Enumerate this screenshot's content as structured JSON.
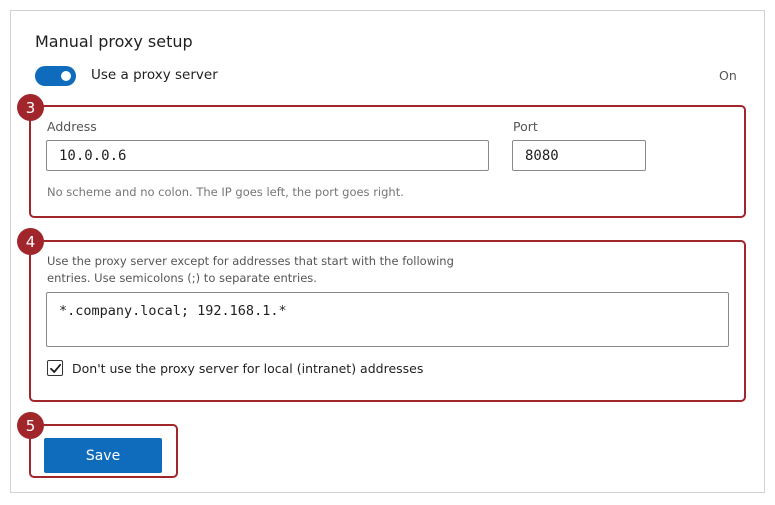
{
  "section": {
    "title": "Manual proxy setup"
  },
  "proxy_toggle": {
    "label": "Use a proxy server",
    "state": "On",
    "enabled": true
  },
  "annotations": [
    "3",
    "4",
    "5"
  ],
  "address": {
    "label": "Address",
    "value": "10.0.0.6"
  },
  "port": {
    "label": "Port",
    "value": "8080"
  },
  "hint": "No scheme and no colon. The IP goes left, the port goes right.",
  "exceptions": {
    "description": "Use the proxy server except for addresses that start with the following entries. Use semicolons (;) to separate entries.",
    "value": "*.company.local; 192.168.1.*"
  },
  "local_checkbox": {
    "label": "Don't use the proxy server for local (intranet) addresses",
    "checked": true
  },
  "save": {
    "label": "Save"
  },
  "colors": {
    "accent": "#0f6cbd",
    "annotation": "#a1262b"
  }
}
